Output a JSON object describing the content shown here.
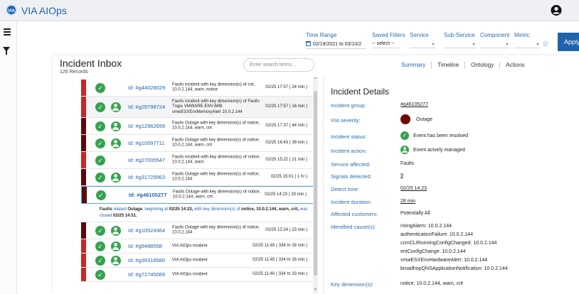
{
  "app": {
    "title": "VIA AIOps",
    "logo_text": "VIA"
  },
  "filters": {
    "time_range": {
      "label": "Time Range",
      "value": "02/19/2021 to 03/10/2"
    },
    "saved_filters": {
      "label": "Saved Filters",
      "value": "-- select --"
    },
    "service": {
      "label": "Service"
    },
    "sub_service": {
      "label": "Sub-Service"
    },
    "component": {
      "label": "Component"
    },
    "metric": {
      "label": "Metric"
    },
    "apply_label": "Apply"
  },
  "inbox": {
    "title": "Incident Inbox",
    "count": "126 Records",
    "search_placeholder": "Enter search terms...",
    "tabs": [
      "Summary",
      "Timeline",
      "Ontology",
      "Actions"
    ],
    "rows": [
      {
        "id": "Id: #g44028029",
        "desc": "Faults incident with key dimension(s) of crit, 10.0.2.144, warn, notice",
        "time": "02/25 17:57 ( 24 min )",
        "sev": "crit",
        "managed": false
      },
      {
        "id": "Id: #g29798724",
        "desc": "Faults incident with key dimension(s) of Faults Traps VMWARE-ENV-MIB vmwESXEnvMemoryAlert 10.0.2.144",
        "time": "02/25 17:57 ( 16 min )",
        "sev": "crit",
        "managed": true
      },
      {
        "id": "Id: #g12962699",
        "desc": "Faults Outage with key dimension(s) of notice, 10.0.2.144, warn, crit",
        "time": "02/25 17:37 ( 44 min )",
        "sev": "out",
        "managed": true
      },
      {
        "id": "Id: #g10097711",
        "desc": "Faults Outage with key dimension(s) of notice, 10.0.2.144, warn, crit",
        "time": "02/25 16:43 ( 39 min )",
        "sev": "out",
        "managed": true
      },
      {
        "id": "Id: #g27005547",
        "desc": "Faults incident with key dimension(s) of notice, 10.0.2.144, warn",
        "time": "02/25 15:22 ( 21 min )",
        "sev": "crit",
        "managed": false
      },
      {
        "id": "Id: #g31729963",
        "desc": "Faults Outage with key dimension(s) of notice, 10.0.2.144",
        "time": "02/25 15:01 ( 1 hr )",
        "sev": "out",
        "managed": true
      },
      {
        "id": "Id: #g46105277",
        "desc": "Faults Outage with key dimension(s) of notice, 10.0.2.144, warn, crit",
        "time": "02/25 14:23 ( 33 min )",
        "sev": "out",
        "managed": false,
        "selected": true
      },
      {
        "id": "Id: #g10524364",
        "desc": "Faults Outage with key dimension(s) of notice, 10.0.2.144",
        "time": "02/25 12:24 ( 23 min )",
        "sev": "out",
        "managed": true
      },
      {
        "id": "Id: #g9488558",
        "desc": "VIA AIOps incident",
        "time": "02/25 11:45 ( 334 hr 28 min )",
        "sev": "crit",
        "managed": true
      },
      {
        "id": "Id: #g39316580",
        "desc": "VIA AIOps incident",
        "time": "02/25 11:45 ( 334 hr 28 min )",
        "sev": "crit",
        "managed": true
      },
      {
        "id": "Id: #g72745089",
        "desc": "VIA AIOps incident",
        "time": "02/25 11:40 ( 334 hr 33 min )",
        "sev": "crit",
        "managed": false
      }
    ],
    "expanded": {
      "p1": "Faults",
      "p2": "related",
      "p3": "Outage, beginning at",
      "p4": "02/25 14:23,",
      "p5": "with key dimension(s) of",
      "p6": "notice, 10.0.2.144, warn, crit,",
      "p7": "was closed",
      "p8": "02/25 14:51."
    }
  },
  "details": {
    "title": "Incident Details",
    "group_label": "Incident group:",
    "group_value": "#g46105277",
    "severity_label": "VIA severity:",
    "severity_value": "Outage",
    "status_label": "Incident status:",
    "status_value": "Event has been resolved",
    "action_label": "Incident action:",
    "action_value": "Event actvely managed",
    "service_label": "Service affected:",
    "service_value": "Faults",
    "signals_label": "Signals detected:",
    "signals_value": "9",
    "detect_label": "Detect time:",
    "detect_value": "02/25 14:23",
    "duration_label": "Incident duration:",
    "duration_value": "28 min",
    "customers_label": "Affected customers:",
    "customers_value": "Potentially All",
    "causes_label": "Identified cause(s):",
    "causes": [
      "risingAlarm: 10.0.2.144",
      "authenticationFailure: 10.0.2.144",
      "ccmCLIRunningConfigChanged: 10.0.2.144",
      "entConfigChange: 10.0.2.144",
      "vmwESXEnvHardwareAlert: 10.0.2.144",
      "broadhopQNSApplicationNotification: 10.0.2.144"
    ],
    "keydim_label": "Key dimension(s):",
    "keydim_value": "notice, 10.0.2.144, warn, crit"
  }
}
